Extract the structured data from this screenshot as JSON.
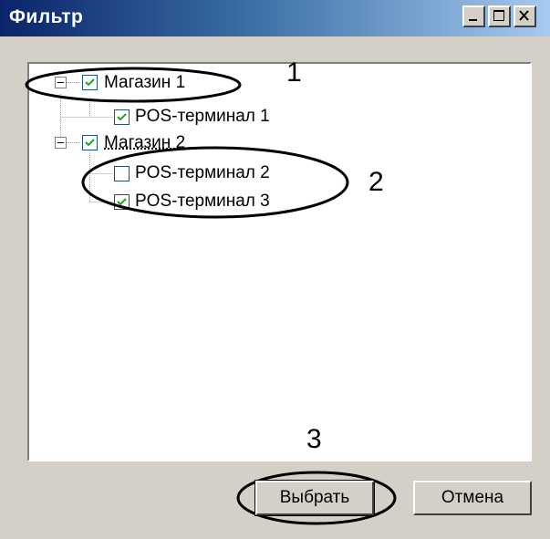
{
  "window": {
    "title": "Фильтр"
  },
  "tree": {
    "nodes": [
      {
        "label": "Магазин 1",
        "checked": true
      },
      {
        "label": "POS-терминал 1",
        "checked": true
      },
      {
        "label": "Магазин 2",
        "checked": true
      },
      {
        "label": "POS-терминал 2",
        "checked": false
      },
      {
        "label": "POS-терминал 3",
        "checked": true
      }
    ]
  },
  "annotations": {
    "one": "1",
    "two": "2",
    "three": "3"
  },
  "buttons": {
    "select_label": "Выбрать",
    "cancel_label": "Отмена"
  }
}
